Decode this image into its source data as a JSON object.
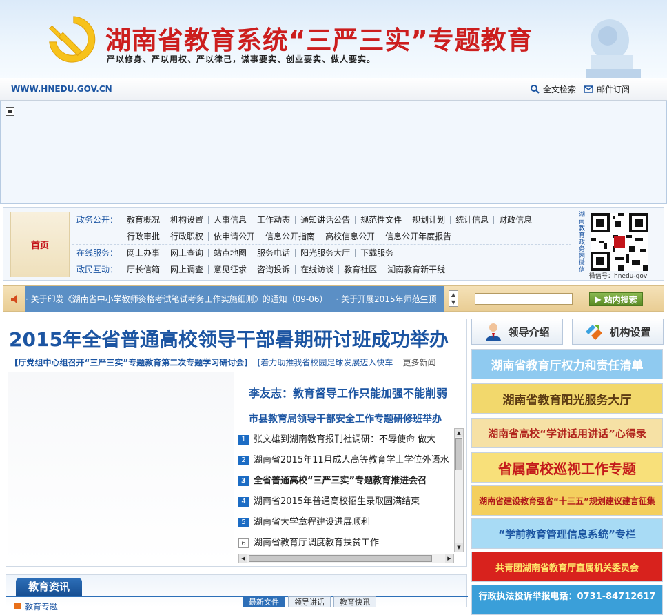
{
  "banner": {
    "title": "湖南省教育系统“三严三实”专题教育",
    "subtitle": "严以修身、严以用权、严以律己，谋事要实、创业要实、做人要实。"
  },
  "urlbar": {
    "url": "WWW.HNEDU.GOV.CN",
    "search_label": "全文检索",
    "mail_label": "邮件订阅"
  },
  "nav": {
    "home_label": "首页",
    "rows": [
      {
        "label": "政务公开：",
        "items": [
          "教育概况",
          "机构设置",
          "人事信息",
          "工作动态",
          "通知讲话公告",
          "规范性文件",
          "规划计划",
          "统计信息",
          "财政信息"
        ]
      },
      {
        "label": "",
        "items": [
          "行政审批",
          "行政职权",
          "依申请公开",
          "信息公开指南",
          "高校信息公开",
          "信息公开年度报告"
        ]
      },
      {
        "label": "在线服务：",
        "items": [
          "网上办事",
          "网上查询",
          "站点地图",
          "服务电话",
          "阳光服务大厅",
          "下载服务"
        ]
      },
      {
        "label": "政民互动：",
        "items": [
          "厅长信箱",
          "网上调查",
          "意见征求",
          "咨询投诉",
          "在线访谈",
          "教育社区",
          "湖南教育新干线"
        ]
      }
    ],
    "qr_side_text": "湖南教育政务网微信",
    "qr_caption": "微信号：hnedu-gov"
  },
  "ticker": {
    "items": [
      "·  关于印发《湖南省中小学教师资格考试笔试考务工作实施细则》的通知（09-06）",
      "·  关于开展2015年师范生顶"
    ],
    "search_button": "站内搜索"
  },
  "main": {
    "headline": "2015年全省普通高校领导干部暑期研讨班成功举办",
    "sub_links": [
      "[厅党组中心组召开“三严三实”专题教育第二次专题学习研讨会]",
      "[着力助推我省校园足球发展迈入快车"
    ],
    "more": "更多新闻",
    "top_headline": "李友志：教育督导工作只能加强不能削弱",
    "sub_headline": "市县教育局领导干部安全工作专题研修班举办",
    "list": [
      {
        "num": "1",
        "text": "张文雄到湖南教育报刊社调研：不辱使命  做大",
        "bold": false,
        "plain": false
      },
      {
        "num": "2",
        "text": "湖南省2015年11月成人高等教育学士学位外语水",
        "bold": false,
        "plain": false
      },
      {
        "num": "3",
        "text": "全省普通高校“三严三实”专题教育推进会召",
        "bold": true,
        "plain": false
      },
      {
        "num": "4",
        "text": "湖南省2015年普通高校招生录取圆满结束",
        "bold": false,
        "plain": false
      },
      {
        "num": "5",
        "text": "湖南省大学章程建设进展顺利",
        "bold": false,
        "plain": false
      },
      {
        "num": "6",
        "text": "湖南省教育厅调度教育扶贫工作",
        "bold": false,
        "plain": true
      }
    ]
  },
  "info": {
    "title": "教育资讯",
    "sub": "教育专题",
    "tabs": [
      "最新文件",
      "领导讲话",
      "教育快讯"
    ]
  },
  "right": {
    "btn_leader": "领导介绍",
    "btn_org": "机构设置",
    "banners": [
      {
        "text": "湖南省教育厅权力和责任清单",
        "bg": "#8fcaf0",
        "fg": "#ffffff"
      },
      {
        "text": "湖南省教育阳光服务大厅",
        "bg": "#f2d86c",
        "fg": "#5b3a13"
      },
      {
        "text": "湖南省高校“学讲话用讲话”心得录",
        "bg": "#f6e1a5",
        "fg": "#b2271f"
      },
      {
        "text": "省属高校巡视工作专题",
        "bg": "#f8e07a",
        "fg": "#c41b1b"
      },
      {
        "text": "湖南省建设教育强省“十三五”规划建议建言征集",
        "bg": "#f4cf5e",
        "fg": "#b0161a"
      },
      {
        "text": "“学前教育管理信息系统”专栏",
        "bg": "#a8dbf5",
        "fg": "#1c55a2"
      },
      {
        "text": "共青团湖南省教育厅直属机关委员会",
        "bg": "#d8221d",
        "fg": "#ffe56a"
      },
      {
        "text": "行政执法投诉举报电话：0731-84712617",
        "bg": "#3a9fd9",
        "fg": "#ffffff"
      }
    ]
  }
}
